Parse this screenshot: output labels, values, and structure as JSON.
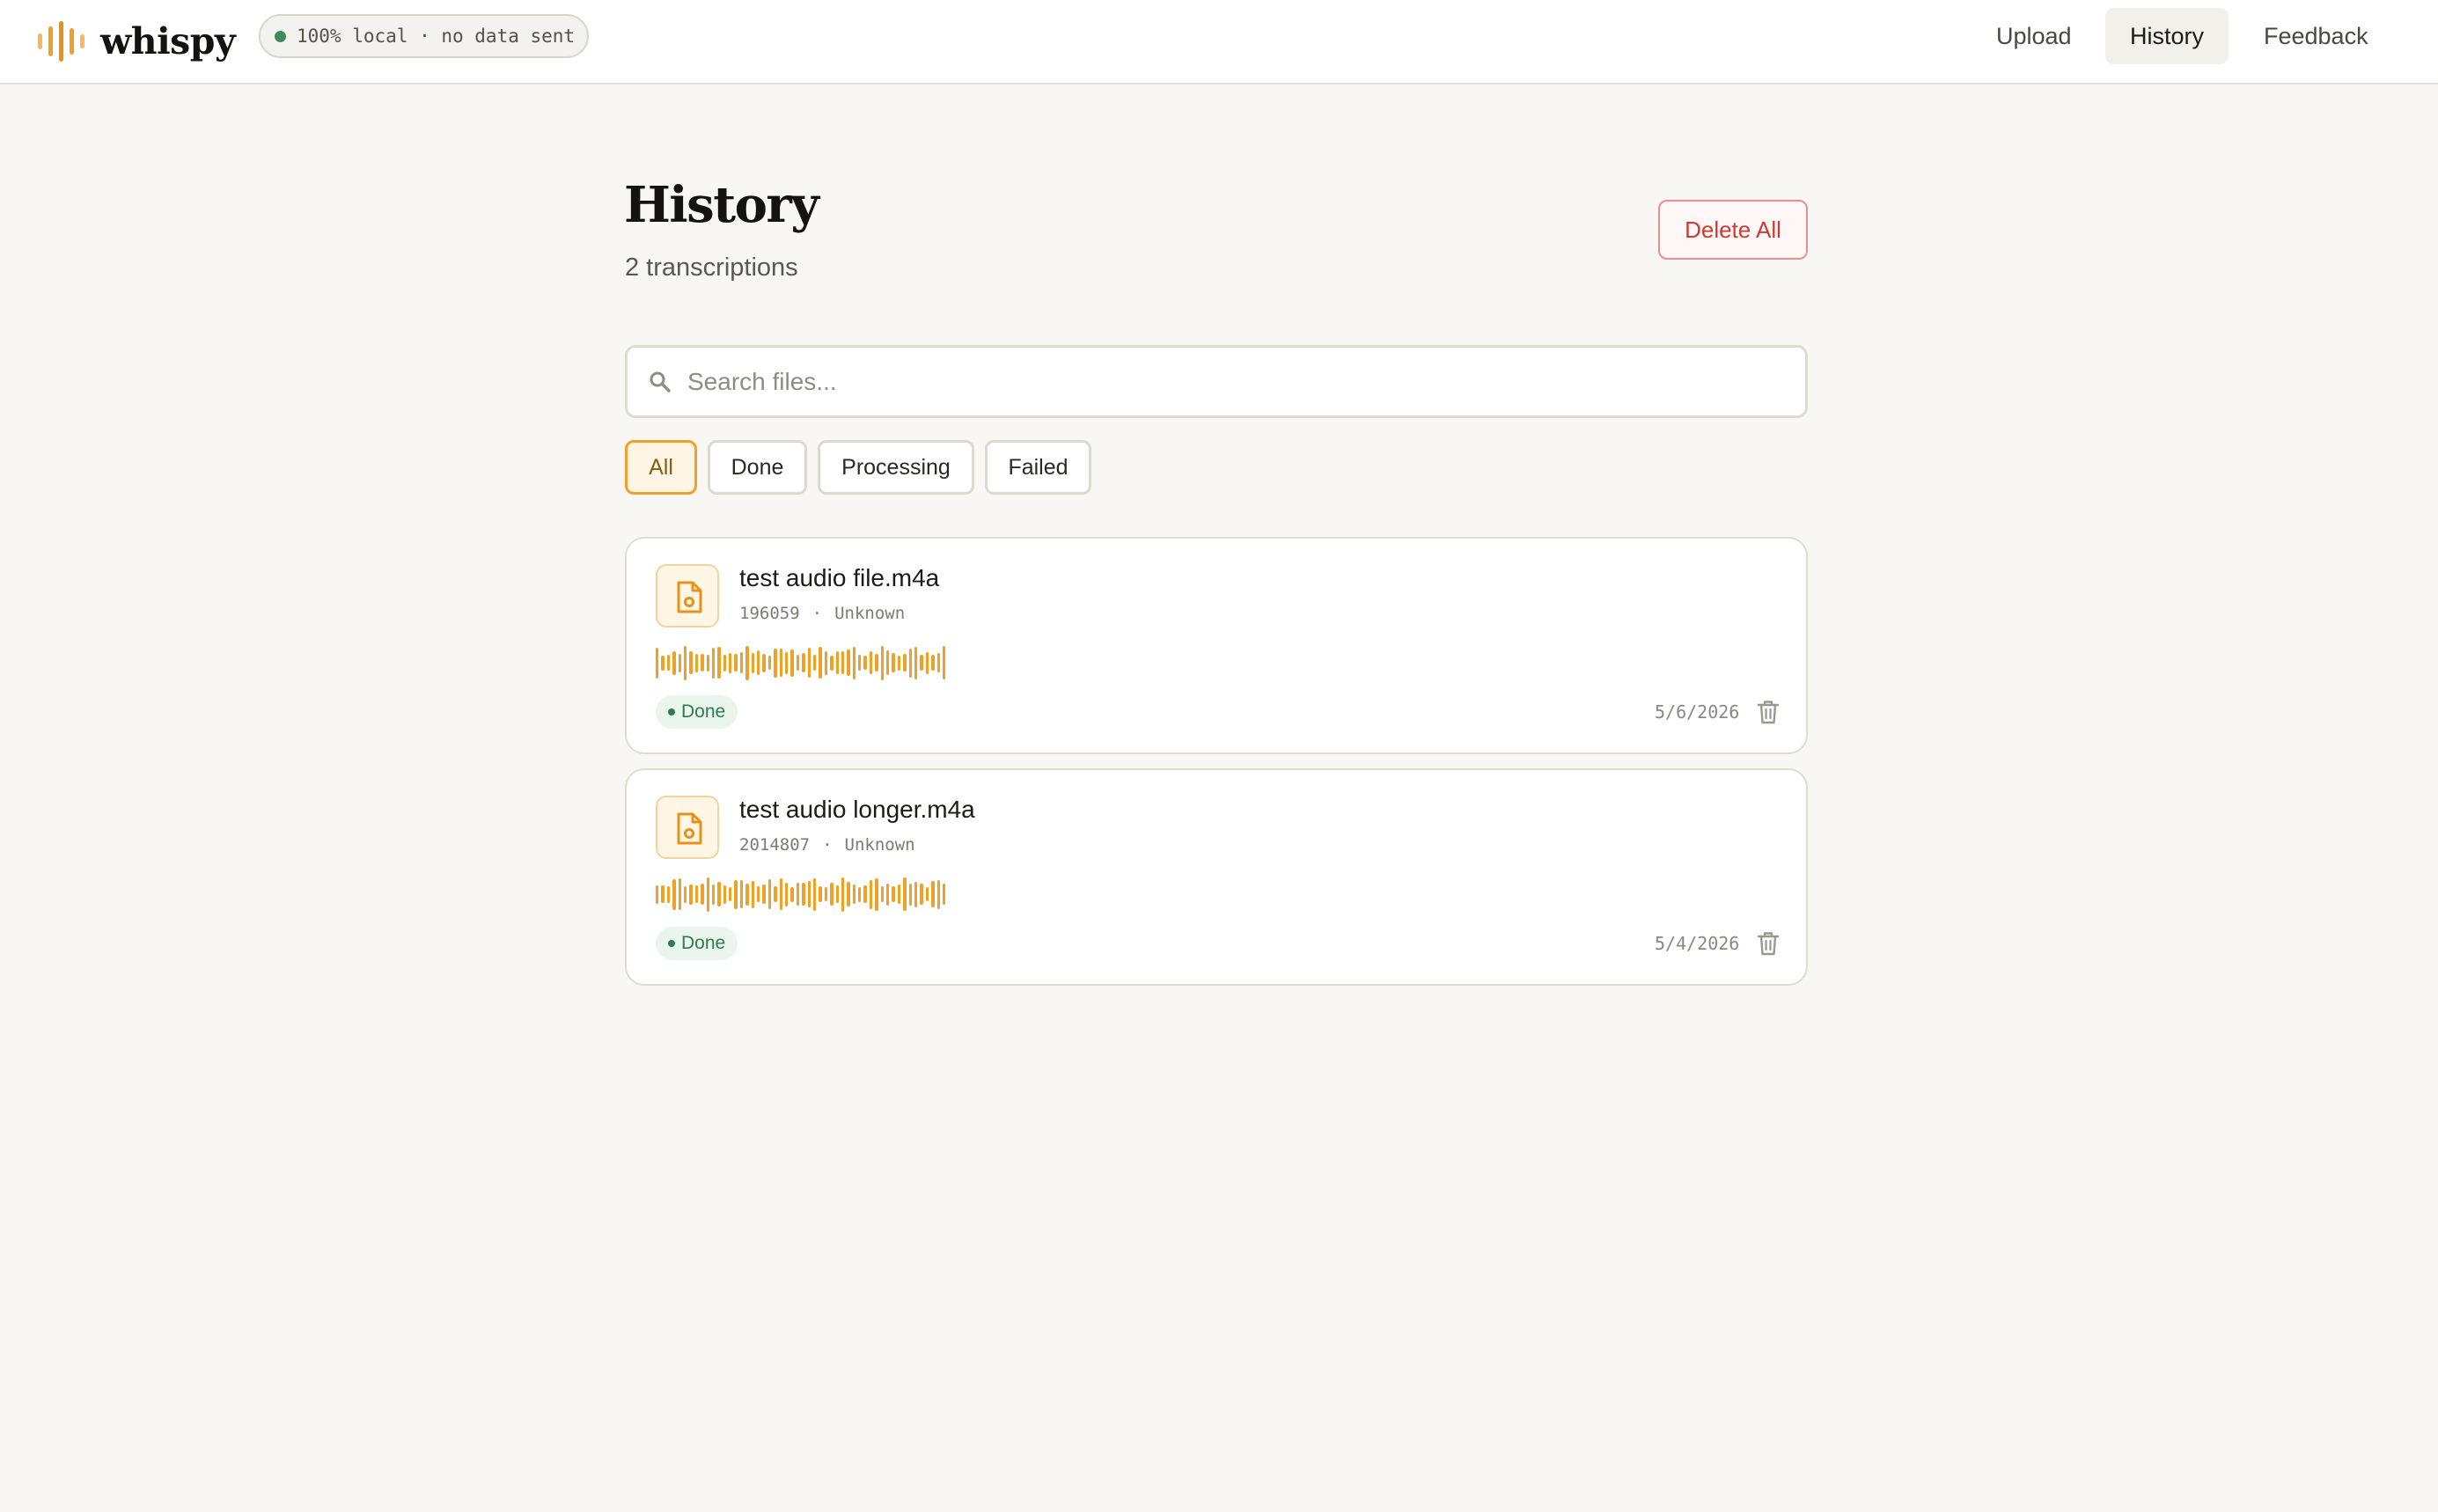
{
  "app": {
    "name": "whispy",
    "privacy_badge": "100% local · no data sent"
  },
  "nav": [
    {
      "label": "Upload",
      "active": false
    },
    {
      "label": "History",
      "active": true
    },
    {
      "label": "Feedback",
      "active": false
    }
  ],
  "page": {
    "title": "History",
    "subtitle": "2 transcriptions",
    "delete_all_label": "Delete All"
  },
  "search": {
    "placeholder": "Search files...",
    "value": ""
  },
  "filters": [
    {
      "label": "All",
      "active": true
    },
    {
      "label": "Done",
      "active": false
    },
    {
      "label": "Processing",
      "active": false
    },
    {
      "label": "Failed",
      "active": false
    }
  ],
  "items": [
    {
      "name": "test audio file.m4a",
      "size": "196059",
      "separator": "·",
      "duration": "Unknown",
      "status": "Done",
      "date": "5/6/2026"
    },
    {
      "name": "test audio longer.m4a",
      "size": "2014807",
      "separator": "·",
      "duration": "Unknown",
      "status": "Done",
      "date": "5/4/2026"
    }
  ],
  "colors": {
    "accent": "#f0a028",
    "done": "#2f7a4f",
    "danger": "#c93c34",
    "background": "#f8f7f4"
  },
  "icons": [
    "waveform-logo-icon",
    "search-icon",
    "audio-file-icon",
    "trash-icon"
  ]
}
